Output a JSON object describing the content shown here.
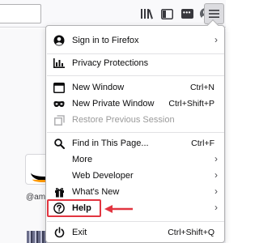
{
  "toolbar": {
    "icons": {
      "library": "library-icon",
      "sidebar": "sidebar-icon",
      "extension": "extension-icon",
      "extension_badge": "•••",
      "account": "account-icon",
      "menu": "hamburger-menu-icon"
    }
  },
  "background": {
    "tile_label": "@am"
  },
  "menu": {
    "items": [
      {
        "label": "Sign in to Firefox",
        "icon": "account-icon",
        "submenu": true
      },
      {
        "label": "Privacy Protections",
        "icon": "chart-icon"
      },
      {
        "label": "New Window",
        "icon": "new-window-icon",
        "shortcut": "Ctrl+N"
      },
      {
        "label": "New Private Window",
        "icon": "mask-icon",
        "shortcut": "Ctrl+Shift+P"
      },
      {
        "label": "Restore Previous Session",
        "icon": "restore-icon",
        "disabled": true
      },
      {
        "label": "Find in This Page...",
        "icon": "search-icon",
        "shortcut": "Ctrl+F"
      },
      {
        "label": "More",
        "submenu": true
      },
      {
        "label": "Web Developer",
        "submenu": true
      },
      {
        "label": "What's New",
        "icon": "gift-icon",
        "submenu": true
      },
      {
        "label": "Help",
        "icon": "help-icon",
        "submenu": true
      },
      {
        "label": "Exit",
        "icon": "power-icon",
        "shortcut": "Ctrl+Shift+Q"
      }
    ]
  },
  "colors": {
    "highlight": "#e23540",
    "menu_border": "#b1b1b3"
  }
}
